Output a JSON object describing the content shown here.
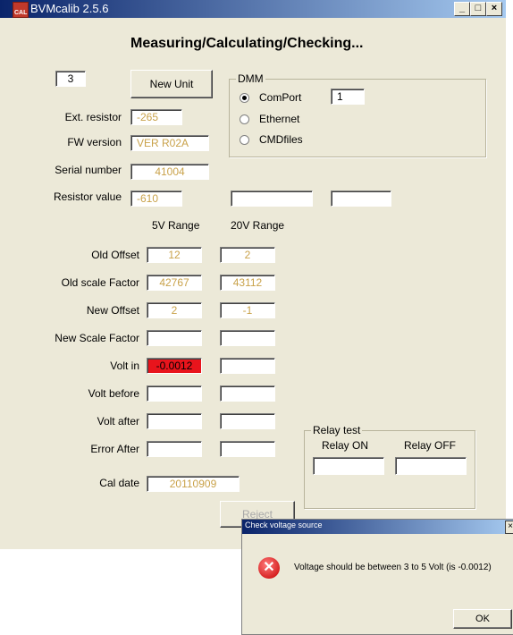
{
  "window": {
    "title": "BVMcalib 2.5.6",
    "icon_text": "CAL",
    "min_label": "_",
    "max_label": "□",
    "close_label": "×"
  },
  "header": "Measuring/Calculating/Checking...",
  "unit": {
    "number": "3",
    "new_unit_label": "New Unit"
  },
  "dmm": {
    "legend": "DMM",
    "options": [
      {
        "label": "ComPort",
        "selected": true
      },
      {
        "label": "Ethernet",
        "selected": false
      },
      {
        "label": "CMDfiles",
        "selected": false
      }
    ],
    "comport_value": "1"
  },
  "fields": {
    "ext_resistor": {
      "label": "Ext. resistor",
      "value": "-265"
    },
    "fw_version": {
      "label": "FW version",
      "value": "VER R02A"
    },
    "serial_number": {
      "label": "Serial number",
      "value": "41004"
    },
    "resistor_value": {
      "label": "Resistor value",
      "value": "-610",
      "extra1": "",
      "extra2": ""
    }
  },
  "ranges": {
    "col5v": "5V Range",
    "col20v": "20V Range"
  },
  "rows": [
    {
      "label": "Old Offset",
      "v5": "12",
      "v20": "2"
    },
    {
      "label": "Old scale Factor",
      "v5": "42767",
      "v20": "43112"
    },
    {
      "label": "New Offset",
      "v5": "2",
      "v20": "-1"
    },
    {
      "label": "New Scale Factor",
      "v5": "",
      "v20": ""
    },
    {
      "label": "Volt in",
      "v5": "-0.0012",
      "v20": ""
    },
    {
      "label": "Volt before",
      "v5": "",
      "v20": ""
    },
    {
      "label": "Volt after",
      "v5": "",
      "v20": ""
    },
    {
      "label": "Error After",
      "v5": "",
      "v20": ""
    }
  ],
  "relay": {
    "legend": "Relay test",
    "on_label": "Relay ON",
    "off_label": "Relay OFF",
    "on_value": "",
    "off_value": ""
  },
  "cal_date": {
    "label": "Cal date",
    "value": "20110909"
  },
  "reject_label": "Reject",
  "dialog": {
    "title": "Check voltage source",
    "message": "Voltage should be between 3 to 5 Volt (is -0.0012)",
    "ok_label": "OK",
    "close_label": "×"
  },
  "colors": {
    "error_bg": "#e8141c",
    "value_text": "#c9a24a"
  }
}
